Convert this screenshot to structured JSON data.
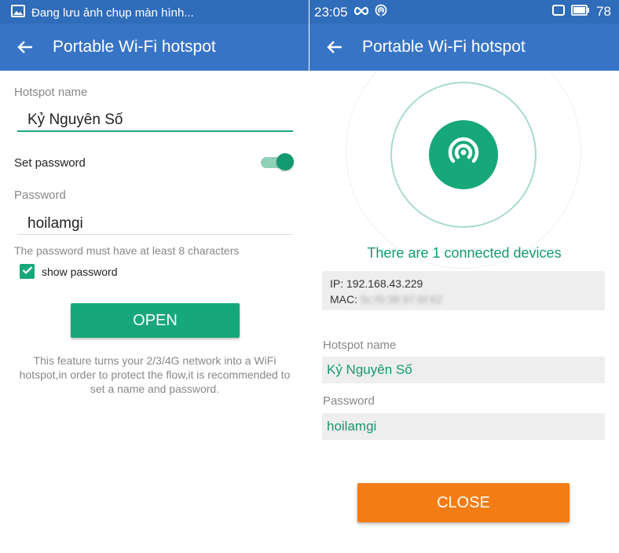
{
  "status_bar": {
    "notification": "Đang lưu ảnh chụp màn hình...",
    "time": "23:05",
    "battery": "78"
  },
  "left": {
    "toolbar_title": "Portable Wi-Fi hotspot",
    "hotspot_name_label": "Hotspot name",
    "hotspot_name_value": "Kỷ Nguyên Số",
    "set_password_label": "Set password",
    "set_password_on": true,
    "password_label": "Password",
    "password_value": "hoilamgi",
    "password_hint": "The password must have at least 8 characters",
    "show_password_label": "show password",
    "show_password_checked": true,
    "open_button": "OPEN",
    "info_text": "This feature turns your 2/3/4G network into a WiFi hotspot,in order to protect the flow,it is recommended to set a name and password."
  },
  "right": {
    "toolbar_title": "Portable Wi-Fi hotspot",
    "connected_text": "There are 1 connected devices",
    "ip_line": "IP: 192.168.43.229",
    "mac_label": "MAC:",
    "mac_value": "5c:f9:38:97:6f:62",
    "hotspot_name_label": "Hotspot name",
    "hotspot_name_value": "Kỷ Nguyên Số",
    "password_label": "Password",
    "password_value": "hoilamgi",
    "close_button": "CLOSE"
  },
  "colors": {
    "status_bar": "#2f6cb9",
    "toolbar": "#3874c6",
    "accent_green": "#17a87a",
    "close_orange": "#f47c14"
  },
  "icons": [
    "image-icon",
    "infinity-icon",
    "hotspot-icon",
    "square-icon",
    "battery-icon",
    "back-arrow-icon",
    "check-icon"
  ]
}
